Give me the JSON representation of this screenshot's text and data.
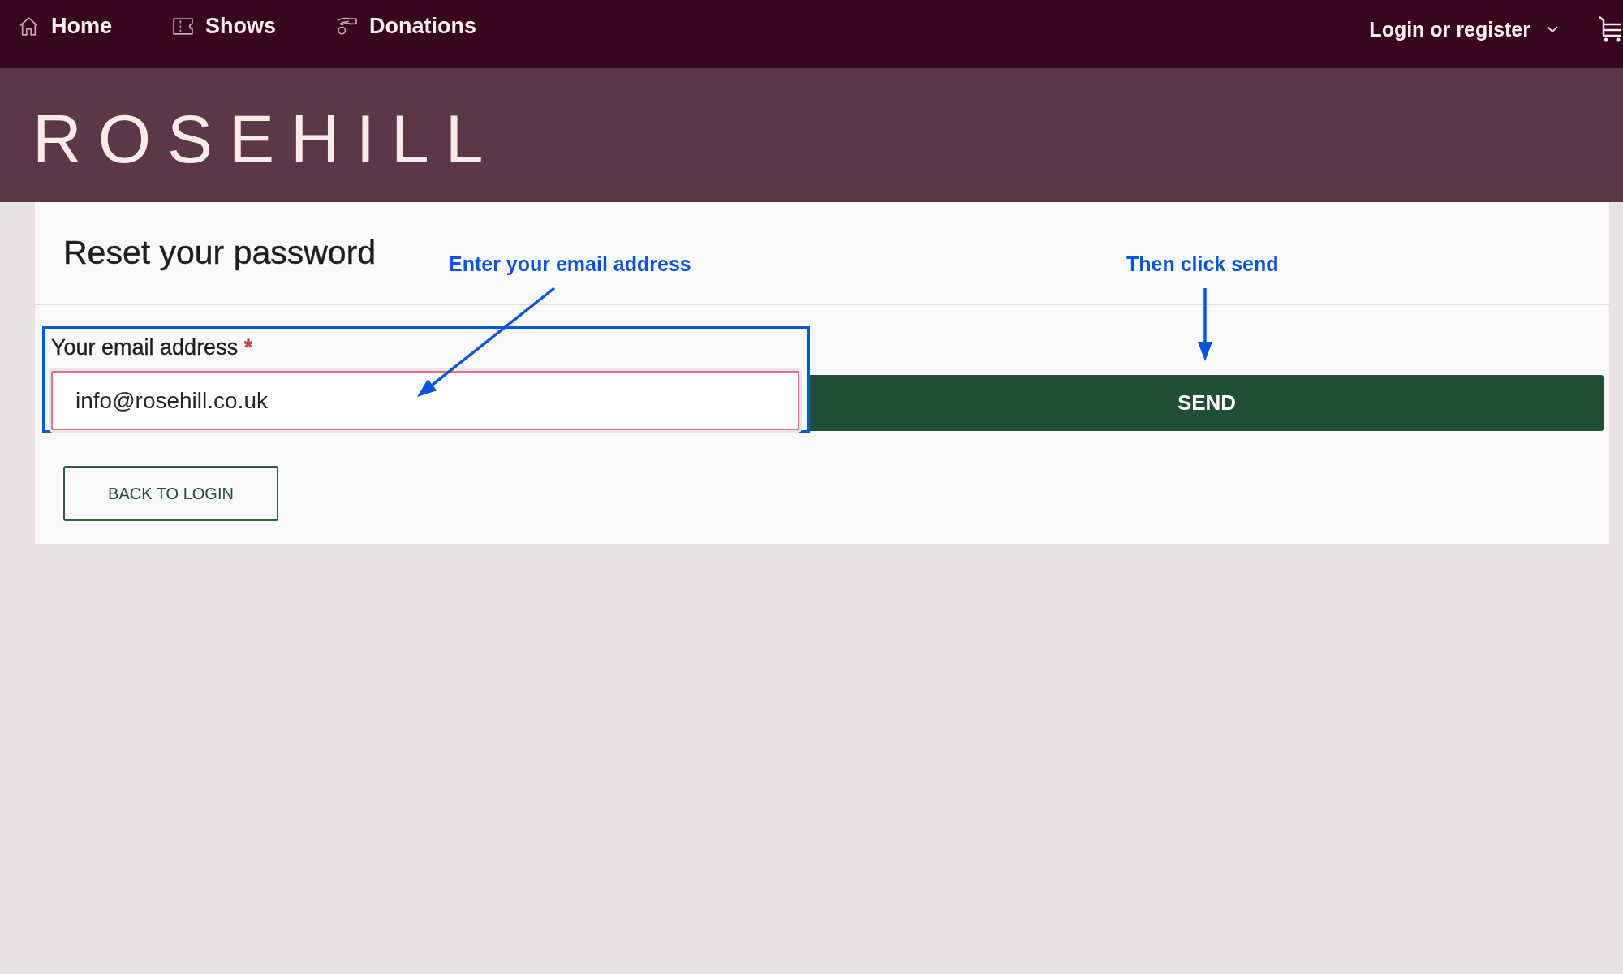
{
  "nav": {
    "items": [
      {
        "label": "Home",
        "kind": "home"
      },
      {
        "label": "Shows",
        "kind": "ticket"
      },
      {
        "label": "Donations",
        "kind": "donation"
      }
    ],
    "account_menu": {
      "label": "Login or register"
    }
  },
  "banner": {
    "logo": "ROSEHILL"
  },
  "form": {
    "title": "Reset your password",
    "email_field": {
      "label": "Your email address",
      "required_mark": "*",
      "value": "info@rosehill.co.uk"
    },
    "submit": "SEND",
    "back": "BACK TO LOGIN"
  },
  "annotations": [
    {
      "text": "Enter your email address",
      "kind": "diagonal"
    },
    {
      "text": "Then click send",
      "kind": "down"
    }
  ]
}
